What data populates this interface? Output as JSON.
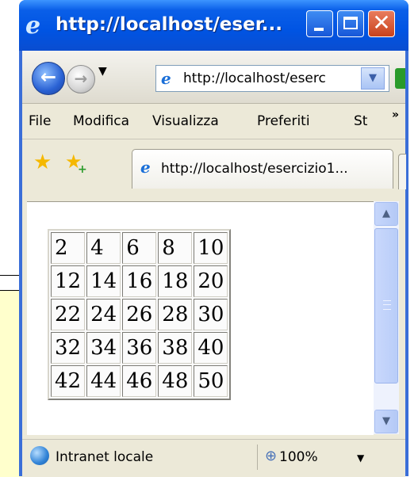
{
  "window": {
    "title": "http://localhost/eser...",
    "close_glyph": "✕"
  },
  "nav": {
    "back_icon": "arrow-left-icon",
    "forward_icon": "arrow-right-icon",
    "address": "http://localhost/eserc"
  },
  "menu": {
    "items": [
      "File",
      "Modifica",
      "Visualizza",
      "Preferiti",
      "St"
    ],
    "more": "»"
  },
  "tab": {
    "label": "http://localhost/esercizio1..."
  },
  "table": {
    "rows": [
      [
        "2",
        "4",
        "6",
        "8",
        "10"
      ],
      [
        "12",
        "14",
        "16",
        "18",
        "20"
      ],
      [
        "22",
        "24",
        "26",
        "28",
        "30"
      ],
      [
        "32",
        "34",
        "36",
        "38",
        "40"
      ],
      [
        "42",
        "44",
        "46",
        "48",
        "50"
      ]
    ]
  },
  "status": {
    "zone": "Intranet locale",
    "zoom": "100%"
  },
  "colors": {
    "titlebar": "#0054e3",
    "chrome": "#ece9d8",
    "slide_box": "#ffffcc"
  }
}
